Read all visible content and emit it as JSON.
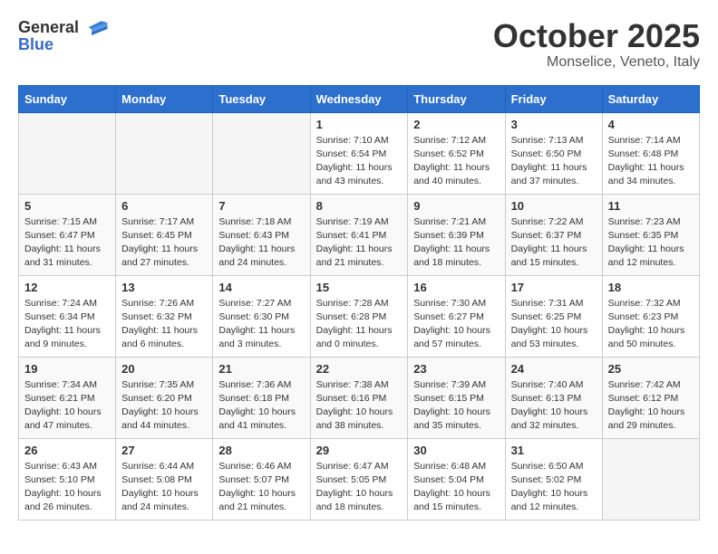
{
  "header": {
    "logo_general": "General",
    "logo_blue": "Blue",
    "month_title": "October 2025",
    "location": "Monselice, Veneto, Italy"
  },
  "days_of_week": [
    "Sunday",
    "Monday",
    "Tuesday",
    "Wednesday",
    "Thursday",
    "Friday",
    "Saturday"
  ],
  "weeks": [
    [
      {
        "day": "",
        "info": ""
      },
      {
        "day": "",
        "info": ""
      },
      {
        "day": "",
        "info": ""
      },
      {
        "day": "1",
        "info": "Sunrise: 7:10 AM\nSunset: 6:54 PM\nDaylight: 11 hours\nand 43 minutes."
      },
      {
        "day": "2",
        "info": "Sunrise: 7:12 AM\nSunset: 6:52 PM\nDaylight: 11 hours\nand 40 minutes."
      },
      {
        "day": "3",
        "info": "Sunrise: 7:13 AM\nSunset: 6:50 PM\nDaylight: 11 hours\nand 37 minutes."
      },
      {
        "day": "4",
        "info": "Sunrise: 7:14 AM\nSunset: 6:48 PM\nDaylight: 11 hours\nand 34 minutes."
      }
    ],
    [
      {
        "day": "5",
        "info": "Sunrise: 7:15 AM\nSunset: 6:47 PM\nDaylight: 11 hours\nand 31 minutes."
      },
      {
        "day": "6",
        "info": "Sunrise: 7:17 AM\nSunset: 6:45 PM\nDaylight: 11 hours\nand 27 minutes."
      },
      {
        "day": "7",
        "info": "Sunrise: 7:18 AM\nSunset: 6:43 PM\nDaylight: 11 hours\nand 24 minutes."
      },
      {
        "day": "8",
        "info": "Sunrise: 7:19 AM\nSunset: 6:41 PM\nDaylight: 11 hours\nand 21 minutes."
      },
      {
        "day": "9",
        "info": "Sunrise: 7:21 AM\nSunset: 6:39 PM\nDaylight: 11 hours\nand 18 minutes."
      },
      {
        "day": "10",
        "info": "Sunrise: 7:22 AM\nSunset: 6:37 PM\nDaylight: 11 hours\nand 15 minutes."
      },
      {
        "day": "11",
        "info": "Sunrise: 7:23 AM\nSunset: 6:35 PM\nDaylight: 11 hours\nand 12 minutes."
      }
    ],
    [
      {
        "day": "12",
        "info": "Sunrise: 7:24 AM\nSunset: 6:34 PM\nDaylight: 11 hours\nand 9 minutes."
      },
      {
        "day": "13",
        "info": "Sunrise: 7:26 AM\nSunset: 6:32 PM\nDaylight: 11 hours\nand 6 minutes."
      },
      {
        "day": "14",
        "info": "Sunrise: 7:27 AM\nSunset: 6:30 PM\nDaylight: 11 hours\nand 3 minutes."
      },
      {
        "day": "15",
        "info": "Sunrise: 7:28 AM\nSunset: 6:28 PM\nDaylight: 11 hours\nand 0 minutes."
      },
      {
        "day": "16",
        "info": "Sunrise: 7:30 AM\nSunset: 6:27 PM\nDaylight: 10 hours\nand 57 minutes."
      },
      {
        "day": "17",
        "info": "Sunrise: 7:31 AM\nSunset: 6:25 PM\nDaylight: 10 hours\nand 53 minutes."
      },
      {
        "day": "18",
        "info": "Sunrise: 7:32 AM\nSunset: 6:23 PM\nDaylight: 10 hours\nand 50 minutes."
      }
    ],
    [
      {
        "day": "19",
        "info": "Sunrise: 7:34 AM\nSunset: 6:21 PM\nDaylight: 10 hours\nand 47 minutes."
      },
      {
        "day": "20",
        "info": "Sunrise: 7:35 AM\nSunset: 6:20 PM\nDaylight: 10 hours\nand 44 minutes."
      },
      {
        "day": "21",
        "info": "Sunrise: 7:36 AM\nSunset: 6:18 PM\nDaylight: 10 hours\nand 41 minutes."
      },
      {
        "day": "22",
        "info": "Sunrise: 7:38 AM\nSunset: 6:16 PM\nDaylight: 10 hours\nand 38 minutes."
      },
      {
        "day": "23",
        "info": "Sunrise: 7:39 AM\nSunset: 6:15 PM\nDaylight: 10 hours\nand 35 minutes."
      },
      {
        "day": "24",
        "info": "Sunrise: 7:40 AM\nSunset: 6:13 PM\nDaylight: 10 hours\nand 32 minutes."
      },
      {
        "day": "25",
        "info": "Sunrise: 7:42 AM\nSunset: 6:12 PM\nDaylight: 10 hours\nand 29 minutes."
      }
    ],
    [
      {
        "day": "26",
        "info": "Sunrise: 6:43 AM\nSunset: 5:10 PM\nDaylight: 10 hours\nand 26 minutes."
      },
      {
        "day": "27",
        "info": "Sunrise: 6:44 AM\nSunset: 5:08 PM\nDaylight: 10 hours\nand 24 minutes."
      },
      {
        "day": "28",
        "info": "Sunrise: 6:46 AM\nSunset: 5:07 PM\nDaylight: 10 hours\nand 21 minutes."
      },
      {
        "day": "29",
        "info": "Sunrise: 6:47 AM\nSunset: 5:05 PM\nDaylight: 10 hours\nand 18 minutes."
      },
      {
        "day": "30",
        "info": "Sunrise: 6:48 AM\nSunset: 5:04 PM\nDaylight: 10 hours\nand 15 minutes."
      },
      {
        "day": "31",
        "info": "Sunrise: 6:50 AM\nSunset: 5:02 PM\nDaylight: 10 hours\nand 12 minutes."
      },
      {
        "day": "",
        "info": ""
      }
    ]
  ]
}
